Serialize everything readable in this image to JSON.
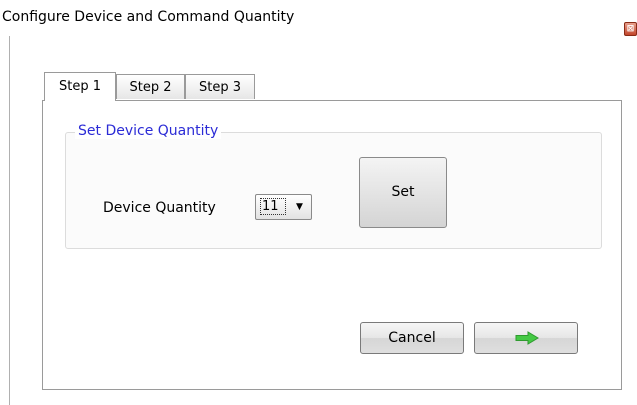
{
  "window": {
    "title": "Configure Device and Command Quantity",
    "close_glyph": "⊠"
  },
  "tabs": [
    {
      "label": "Step 1",
      "active": true
    },
    {
      "label": "Step 2",
      "active": false
    },
    {
      "label": "Step 3",
      "active": false
    }
  ],
  "group": {
    "legend": "Set Device Quantity",
    "legend_color": "#2b2bd6",
    "device_quantity_label": "Device Quantity",
    "device_quantity_value": "11",
    "dropdown_icon": "chevron-down-icon",
    "set_label": "Set"
  },
  "footer": {
    "cancel_label": "Cancel",
    "next_icon": "right-arrow-icon",
    "next_icon_color": "#44c944"
  }
}
